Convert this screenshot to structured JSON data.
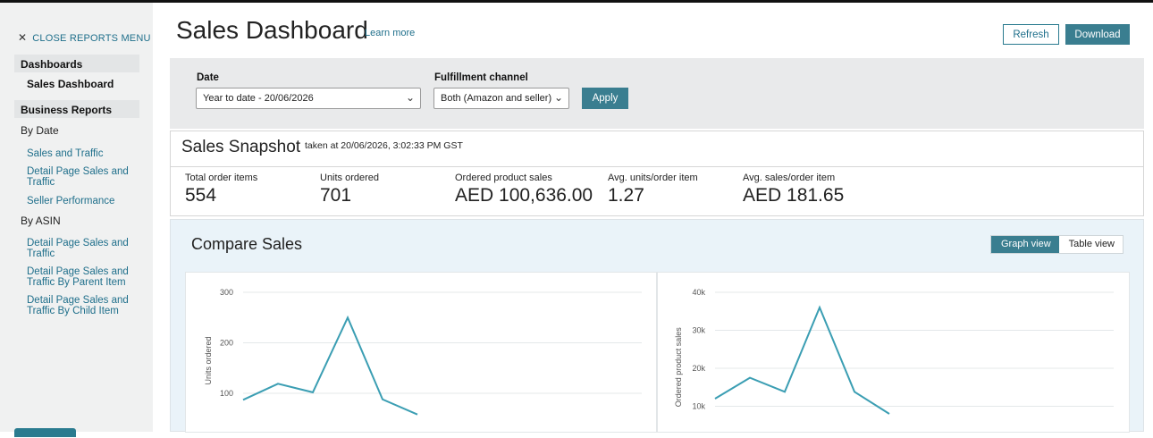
{
  "sidebar": {
    "close_menu": "CLOSE REPORTS MENU",
    "section_dashboards": "Dashboards",
    "active_item": "Sales Dashboard",
    "section_business_reports": "Business Reports",
    "group_by_date": "By Date",
    "by_date_links": [
      "Sales and Traffic",
      "Detail Page Sales and Traffic",
      "Seller Performance"
    ],
    "group_by_asin": "By ASIN",
    "by_asin_links": [
      "Detail Page Sales and Traffic",
      "Detail Page Sales and Traffic By Parent Item",
      "Detail Page Sales and Traffic By Child Item"
    ]
  },
  "header": {
    "title": "Sales Dashboard",
    "learn_more": "Learn more",
    "refresh_label": "Refresh",
    "download_label": "Download"
  },
  "filters": {
    "date_label": "Date",
    "date_value": "Year to date - 20/06/2026",
    "channel_label": "Fulfillment channel",
    "channel_value": "Both (Amazon and seller)",
    "apply_label": "Apply"
  },
  "snapshot": {
    "title": "Sales Snapshot",
    "taken": "taken at 20/06/2026, 3:02:33 PM GST",
    "metrics": [
      {
        "label": "Total order items",
        "value": "554"
      },
      {
        "label": "Units ordered",
        "value": "701"
      },
      {
        "label": "Ordered product sales",
        "value": "AED 100,636.00"
      },
      {
        "label": "Avg. units/order item",
        "value": "1.27"
      },
      {
        "label": "Avg. sales/order item",
        "value": "AED 181.65"
      }
    ]
  },
  "compare": {
    "title": "Compare Sales",
    "graph_view": "Graph view",
    "table_view": "Table view"
  },
  "colors": {
    "accent": "#3a7e90",
    "link": "#1f6f8b",
    "line": "#3b9eb3"
  },
  "chart_data": [
    {
      "type": "line",
      "ylabel": "Units ordered",
      "yticks": [
        "300",
        "200",
        "100"
      ],
      "ylim": [
        0,
        300
      ],
      "series": [
        {
          "values": [
            87,
            119,
            102,
            250,
            88,
            58
          ]
        }
      ]
    },
    {
      "type": "line",
      "ylabel": "Ordered product sales",
      "yticks": [
        "40k",
        "30k",
        "20k",
        "10k"
      ],
      "ylim": [
        0,
        40000
      ],
      "series": [
        {
          "values": [
            12000,
            17500,
            13800,
            36000,
            13800,
            8000
          ]
        }
      ]
    }
  ]
}
